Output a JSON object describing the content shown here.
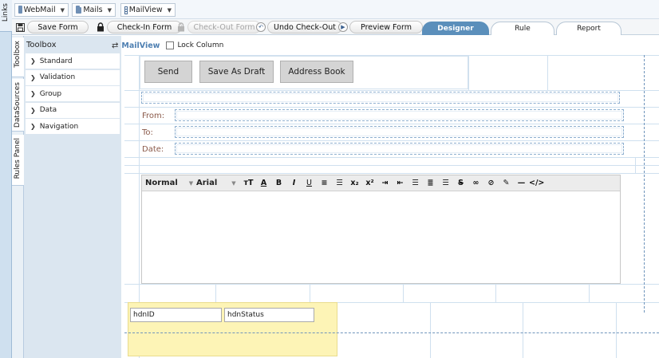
{
  "side_strip": {
    "links_label": "Links",
    "tabs": [
      {
        "label": "Toolbox"
      },
      {
        "label": "DataSources"
      },
      {
        "label": "Rules Panel"
      }
    ]
  },
  "breadcrumb": [
    {
      "label": "WebMail",
      "icon": "folder-icon"
    },
    {
      "label": "Mails",
      "icon": "folder-icon"
    },
    {
      "label": "MailView",
      "icon": "form-view-icon"
    }
  ],
  "toolbar": {
    "save_form": "Save Form",
    "check_in": "Check-In Form",
    "check_out": "Check-Out Form",
    "undo_check_out": "Undo Check-Out",
    "preview_form": "Preview Form"
  },
  "tabs": [
    {
      "label": "Designer",
      "active": true
    },
    {
      "label": "Rule",
      "active": false
    },
    {
      "label": "Report",
      "active": false
    }
  ],
  "toolbox": {
    "title": "Toolbox",
    "items": [
      {
        "label": "Standard"
      },
      {
        "label": "Validation"
      },
      {
        "label": "Group"
      },
      {
        "label": "Data"
      },
      {
        "label": "Navigation"
      }
    ]
  },
  "designer": {
    "view_name": "MailView",
    "lock_column_label": "Lock Column",
    "lock_column_checked": false,
    "buttons": [
      "Send",
      "Save As Draft",
      "Address Book"
    ],
    "fields": [
      {
        "label": "From:"
      },
      {
        "label": "To:"
      },
      {
        "label": "Date:"
      }
    ],
    "rte": {
      "format": "Normal",
      "font": "Arial",
      "icons": [
        "font-size-icon",
        "font-color-icon",
        "bold-icon",
        "italic-icon",
        "underline-icon",
        "ordered-list-icon",
        "unordered-list-icon",
        "subscript-icon",
        "superscript-icon",
        "indent-icon",
        "outdent-icon",
        "align-left-icon",
        "align-center-icon",
        "align-right-icon",
        "strikethrough-icon",
        "link-icon",
        "unlink-icon",
        "highlight-icon",
        "horizontal-rule-icon",
        "source-code-icon"
      ]
    },
    "hidden_fields": [
      {
        "label": "hdnID"
      },
      {
        "label": "hdnStatus"
      }
    ]
  },
  "colors": {
    "tab_active": "#5b8fbb",
    "view_label": "#4f80b2",
    "field_label": "#8b5a4a",
    "hidden_panel": "#fdf4b6",
    "guide_dash": "#6f94bb"
  }
}
